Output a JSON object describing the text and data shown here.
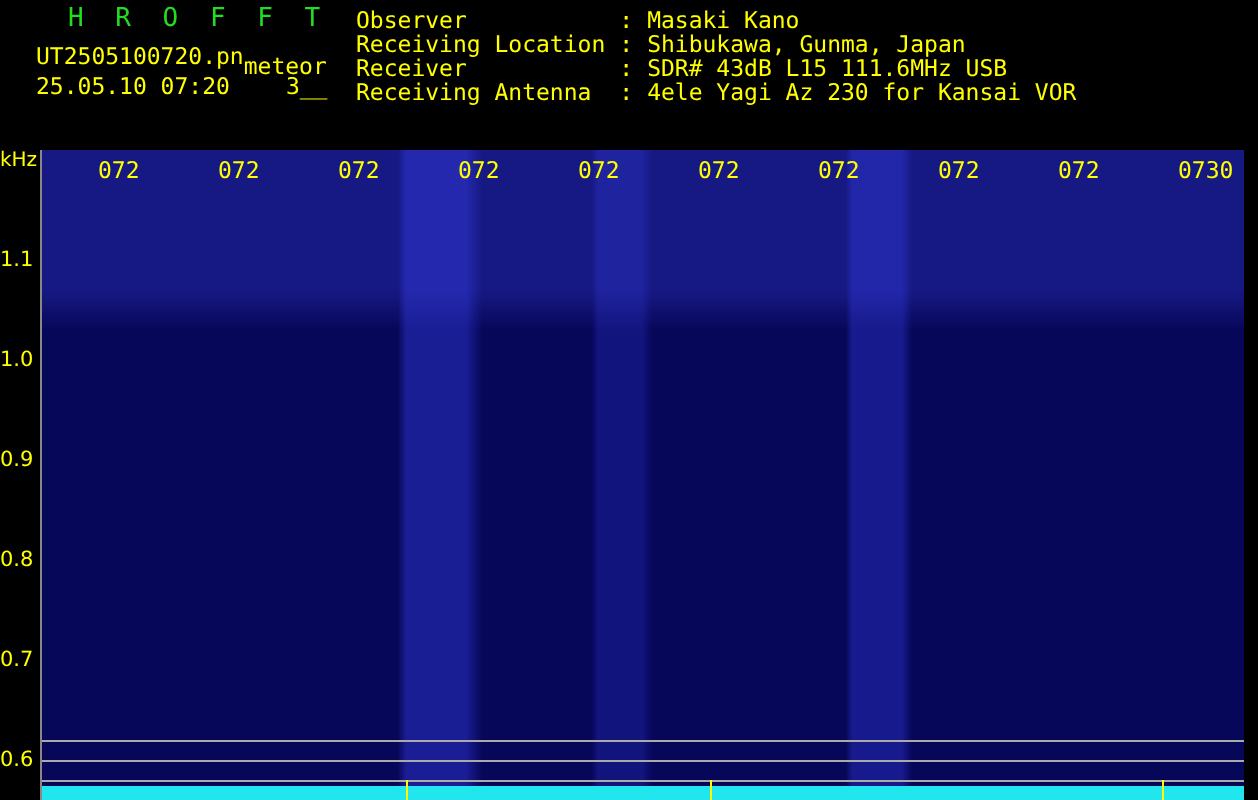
{
  "header": {
    "title": "H R O F F T",
    "filename": "UT2505100720.pn",
    "tag": "meteor",
    "datetime": "25.05.10 07:20",
    "count": "3__"
  },
  "info": [
    {
      "label": "Observer",
      "sep": ":",
      "value": "Masaki Kano"
    },
    {
      "label": "Receiving Location",
      "sep": ":",
      "value": "Shibukawa, Gunma, Japan"
    },
    {
      "label": "Receiver",
      "sep": ":",
      "value": "SDR# 43dB L15 111.6MHz USB"
    },
    {
      "label": "Receiving Antenna",
      "sep": ":",
      "value": "4ele Yagi Az 230 for Kansai VOR"
    }
  ],
  "spectrogram": {
    "unit": "kHz",
    "time_labels": [
      "072",
      "072",
      "072",
      "072",
      "072",
      "072",
      "072",
      "072",
      "072",
      "0730"
    ],
    "y_labels": [
      "1.1",
      "1.0",
      "0.9",
      "0.8",
      "0.7",
      "0.6"
    ]
  }
}
